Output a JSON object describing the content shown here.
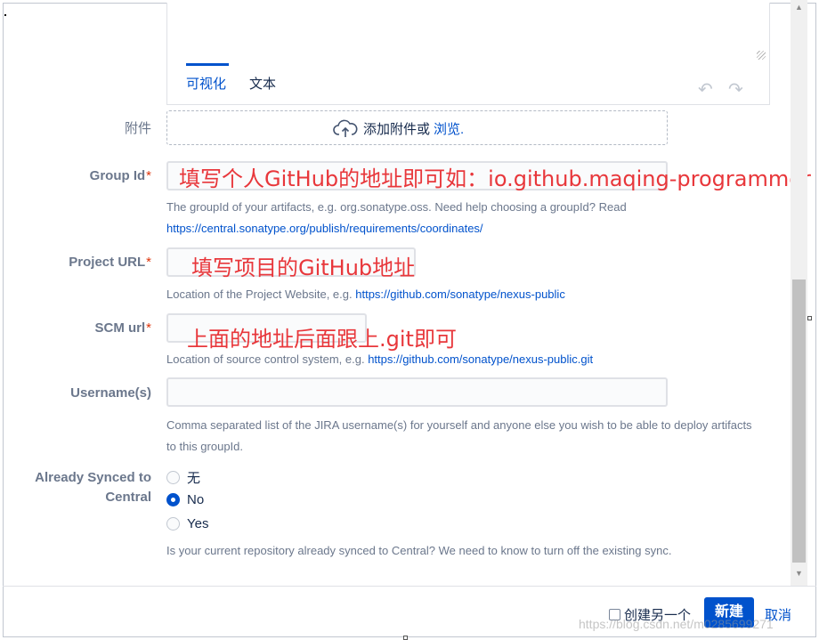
{
  "editor": {
    "tabs": [
      "可视化",
      "文本"
    ]
  },
  "attachment": {
    "label": "附件",
    "text": "添加附件或",
    "browse": "浏览."
  },
  "fields": {
    "group_id": {
      "label": "Group Id",
      "required_mark": "*",
      "annotation": "填写个人GitHub的地址即可如：io.github.maqing-programmer",
      "help_text": "The groupId of your artifacts, e.g. org.sonatype.oss. Need help choosing a groupId? Read",
      "help_link": "https://central.sonatype.org/publish/requirements/coordinates/"
    },
    "project_url": {
      "label": "Project URL",
      "required_mark": "*",
      "annotation": "填写项目的GitHub地址",
      "help_text": "Location of the Project Website, e.g.",
      "help_link": "https://github.com/sonatype/nexus-public"
    },
    "scm_url": {
      "label": "SCM url",
      "required_mark": "*",
      "annotation": "上面的地址后面跟上.git即可",
      "help_text": "Location of source control system, e.g.",
      "help_link": "https://github.com/sonatype/nexus-public.git"
    },
    "usernames": {
      "label": "Username(s)",
      "value": "",
      "help_line1": "Comma separated list of the JIRA username(s) for yourself and anyone else you wish to be able to deploy artifacts",
      "help_line2": "to this groupId."
    },
    "already_synced": {
      "label_line1": "Already Synced to",
      "label_line2": "Central",
      "options": [
        "无",
        "No",
        "Yes"
      ],
      "selected": "No",
      "help_text": "Is your current repository already synced to Central? We need to know to turn off the existing sync."
    }
  },
  "footer": {
    "create_another": "创建另一个",
    "create_button": "新建",
    "cancel": "取消"
  },
  "watermark": "https://blog.csdn.net/m0285699271",
  "colors": {
    "accent": "#0052cc",
    "annotation": "#e8373b",
    "required": "#de350b"
  }
}
